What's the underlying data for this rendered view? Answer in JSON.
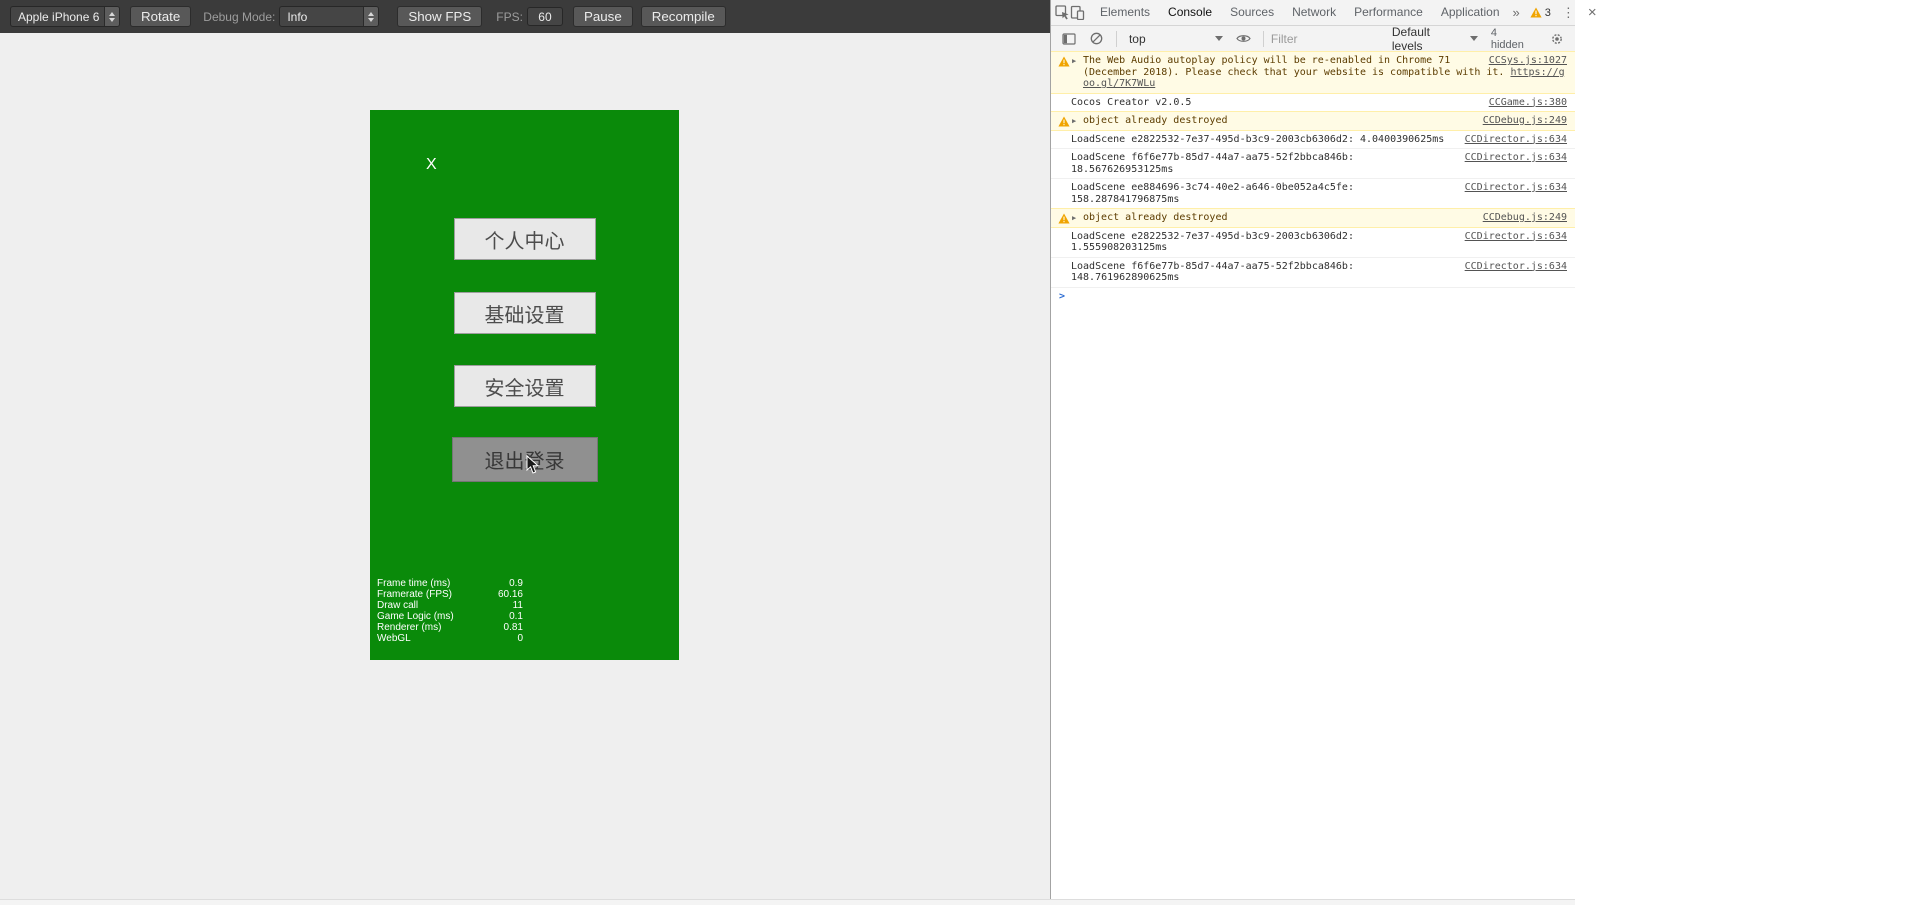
{
  "simulator": {
    "toolbar": {
      "device_select": "Apple iPhone 6",
      "rotate_button": "Rotate",
      "debug_mode_label": "Debug Mode:",
      "debug_mode_select": "Info",
      "show_fps_button": "Show FPS",
      "fps_label": "FPS:",
      "fps_value": "60",
      "pause_button": "Pause",
      "recompile_button": "Recompile"
    },
    "game": {
      "canvas_color": "#0a8a0a",
      "close_button": "X",
      "menu_buttons": [
        {
          "label": "个人中心",
          "pressed": false
        },
        {
          "label": "基础设置",
          "pressed": false
        },
        {
          "label": "安全设置",
          "pressed": false
        },
        {
          "label": "退出登录",
          "pressed": true
        }
      ],
      "profiler": [
        {
          "label": "Frame time (ms)",
          "value": "0.9"
        },
        {
          "label": "Framerate (FPS)",
          "value": "60.16"
        },
        {
          "label": "Draw call",
          "value": "11"
        },
        {
          "label": "Game Logic (ms)",
          "value": "0.1"
        },
        {
          "label": "Renderer (ms)",
          "value": "0.81"
        },
        {
          "label": "WebGL",
          "value": "0"
        }
      ]
    }
  },
  "devtools": {
    "tabs": [
      {
        "label": "Elements",
        "selected": false
      },
      {
        "label": "Console",
        "selected": true
      },
      {
        "label": "Sources",
        "selected": false
      },
      {
        "label": "Network",
        "selected": false
      },
      {
        "label": "Performance",
        "selected": false
      },
      {
        "label": "Application",
        "selected": false
      }
    ],
    "more_tabs_symbol": "»",
    "error_badge_count": "3",
    "kebab_symbol": "⋮",
    "close_symbol": "×",
    "console_toolbar": {
      "context_select": "top",
      "filter_placeholder": "Filter",
      "levels_select": "Default levels",
      "hidden_count_label": "4 hidden"
    },
    "messages": [
      {
        "type": "warning",
        "expandable": true,
        "text": "The Web Audio autoplay policy will be re-enabled in Chrome 71 (December 2018). Please check that your website is compatible with it. ",
        "link_text": "https://goo.gl/7K7WLu",
        "source": "CCSys.js:1027"
      },
      {
        "type": "log",
        "expandable": false,
        "text": "Cocos Creator v2.0.5",
        "source": "CCGame.js:380"
      },
      {
        "type": "warning",
        "expandable": true,
        "text": "object already destroyed",
        "source": "CCDebug.js:249"
      },
      {
        "type": "log",
        "expandable": false,
        "text": "LoadScene e2822532-7e37-495d-b3c9-2003cb6306d2: 4.0400390625ms",
        "source": "CCDirector.js:634"
      },
      {
        "type": "log",
        "expandable": false,
        "text": "LoadScene f6f6e77b-85d7-44a7-aa75-52f2bbca846b:\n18.567626953125ms",
        "source": "CCDirector.js:634"
      },
      {
        "type": "log",
        "expandable": false,
        "text": "LoadScene ee884696-3c74-40e2-a646-0be052a4c5fe:\n158.287841796875ms",
        "source": "CCDirector.js:634"
      },
      {
        "type": "warning",
        "expandable": true,
        "text": "object already destroyed",
        "source": "CCDebug.js:249"
      },
      {
        "type": "log",
        "expandable": false,
        "text": "LoadScene e2822532-7e37-495d-b3c9-2003cb6306d2:\n1.555908203125ms",
        "source": "CCDirector.js:634"
      },
      {
        "type": "log",
        "expandable": false,
        "text": "LoadScene f6f6e77b-85d7-44a7-aa75-52f2bbca846b:\n148.761962890625ms",
        "source": "CCDirector.js:634"
      }
    ],
    "prompt_symbol": ">"
  }
}
